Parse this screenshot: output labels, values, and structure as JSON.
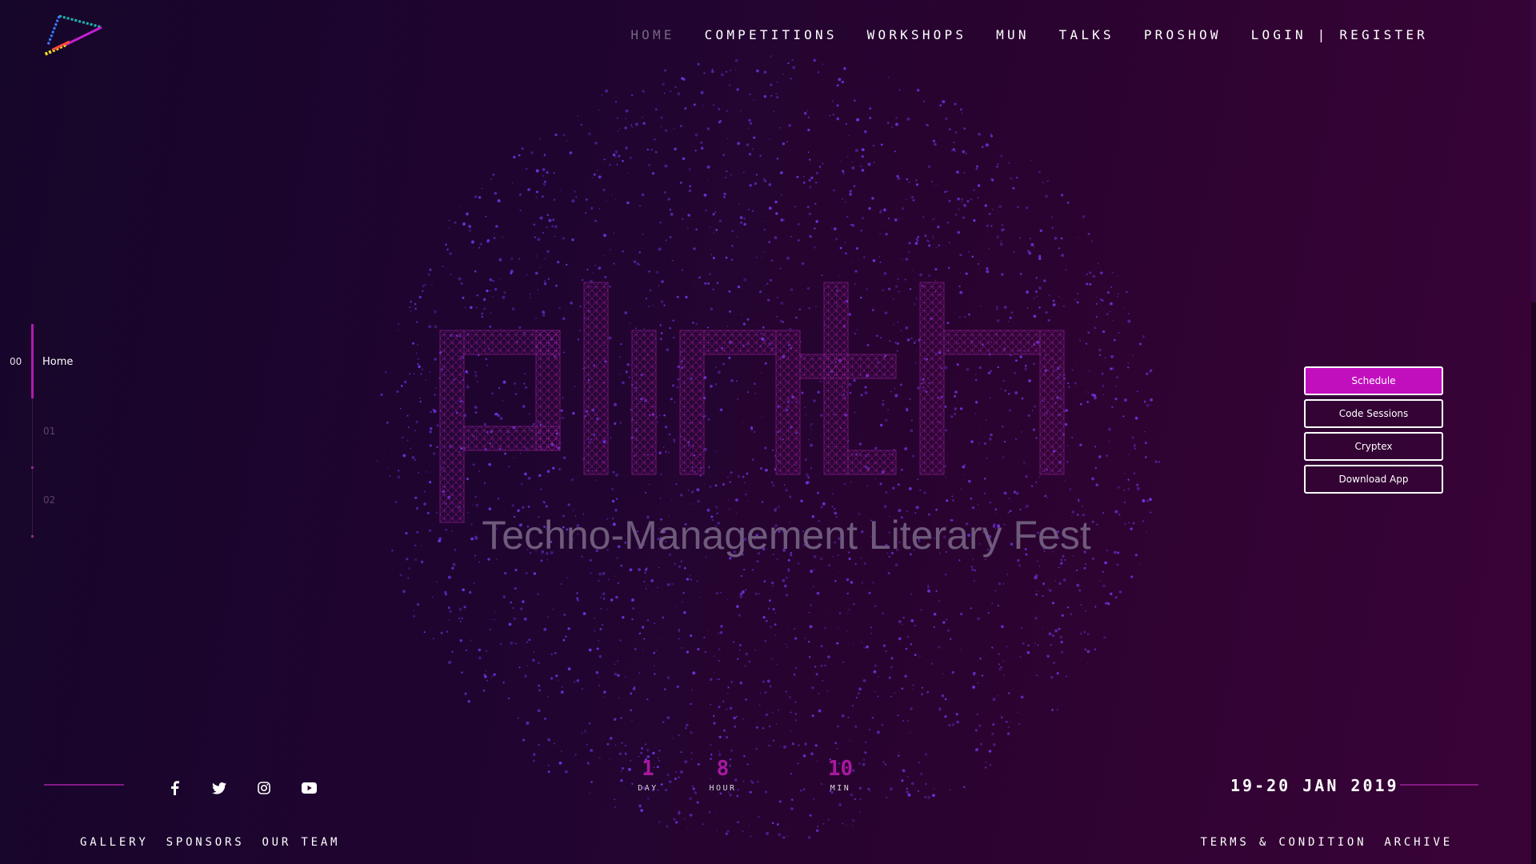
{
  "header": {
    "logo": "plinth-logo",
    "nav": [
      {
        "label": "HOME",
        "active": true
      },
      {
        "label": "COMPETITIONS",
        "active": false
      },
      {
        "label": "WORKSHOPS",
        "active": false
      },
      {
        "label": "MUN",
        "active": false
      },
      {
        "label": "TALKS",
        "active": false
      },
      {
        "label": "PROSHOW",
        "active": false
      },
      {
        "label": "LOGIN | REGISTER",
        "active": false
      }
    ]
  },
  "sections": {
    "items": [
      {
        "number": "00",
        "label": "Home",
        "active": true
      },
      {
        "number": "01",
        "label": "",
        "active": false
      },
      {
        "number": "02",
        "label": "",
        "active": false
      }
    ]
  },
  "hero": {
    "brand": "plinth",
    "tagline": "Techno-Management Literary Fest"
  },
  "actions": [
    {
      "label": "Schedule",
      "primary": true
    },
    {
      "label": "Code Sessions",
      "primary": false
    },
    {
      "label": "Cryptex",
      "primary": false
    },
    {
      "label": "Download App",
      "primary": false
    }
  ],
  "social": [
    {
      "icon": "facebook-icon"
    },
    {
      "icon": "twitter-icon"
    },
    {
      "icon": "instagram-icon"
    },
    {
      "icon": "youtube-icon"
    }
  ],
  "countdown": {
    "day": {
      "value": "1",
      "label": "DAY"
    },
    "hour": {
      "value": "8",
      "label": "HOUR"
    },
    "min": {
      "value": "10",
      "label": "MIN"
    }
  },
  "event_date": "19-20 JAN 2019",
  "footer": {
    "left": [
      "GALLERY",
      "SPONSORS",
      "OUR TEAM"
    ],
    "right": [
      "TERMS & CONDITION",
      "ARCHIVE"
    ]
  },
  "colors": {
    "accent": "#c20fbe",
    "countdown": "#a8189f",
    "background_start": "#16062a",
    "background_end": "#3a0338",
    "particle": "#7b3cff"
  }
}
